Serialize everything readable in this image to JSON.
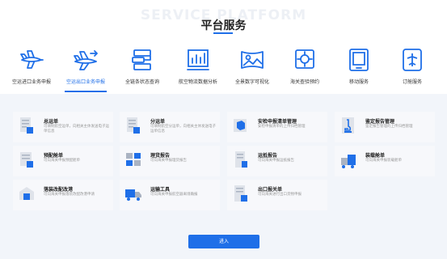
{
  "header": {
    "bg_title": "SERVICE PLATFORM",
    "title": "平台服务"
  },
  "tabs": [
    {
      "label": "空运进口业务申报",
      "icon": "plane-in-icon"
    },
    {
      "label": "空运出口业务申报",
      "icon": "plane-out-icon",
      "active": true
    },
    {
      "label": "全链条状态查询",
      "icon": "chain-status-icon"
    },
    {
      "label": "航空物流数据分析",
      "icon": "data-analysis-icon"
    },
    {
      "label": "全景数字可视化",
      "icon": "panorama-icon"
    },
    {
      "label": "海关查验预约",
      "icon": "inspection-icon"
    },
    {
      "label": "移动服务",
      "icon": "tablet-icon"
    },
    {
      "label": "订舱服务",
      "icon": "booking-icon"
    }
  ],
  "cards": [
    {
      "name": "总运单",
      "desc": "可填制航空运单，向相关主体发送电子运单信息",
      "icon": "master-waybill-icon"
    },
    {
      "name": "分运单",
      "desc": "可填制航空分运单，向相关主体发送电子运单信息",
      "icon": "house-waybill-icon"
    },
    {
      "name": "安检申报清单管理",
      "desc": "安检申报清单的上传归档管理",
      "icon": "security-list-icon"
    },
    {
      "name": "鉴定报告管理",
      "desc": "鉴定报告管理的上传归档管理",
      "icon": "appraisal-report-icon"
    },
    {
      "name": "预配舱单",
      "desc": "可向海关申报预配舱单",
      "icon": "pre-manifest-icon"
    },
    {
      "name": "理货报告",
      "desc": "可向海关申报理货报告",
      "icon": "tally-report-icon"
    },
    {
      "name": "运抵报告",
      "desc": "可向海关申报运抵报告",
      "icon": "arrival-report-icon"
    },
    {
      "name": "装载舱单",
      "desc": "可向海关申报装载舱单",
      "icon": "loading-manifest-icon"
    },
    {
      "name": "落装改配改港",
      "desc": "可向海关申报落装改配改港申请",
      "icon": "reassign-icon"
    },
    {
      "name": "运输工具",
      "desc": "可向海关申报航空器离境确报",
      "icon": "transport-icon"
    },
    {
      "name": "出口报关单",
      "desc": "可向海关进行出口货物申报",
      "icon": "export-declaration-icon"
    }
  ],
  "enter_label": "进入"
}
